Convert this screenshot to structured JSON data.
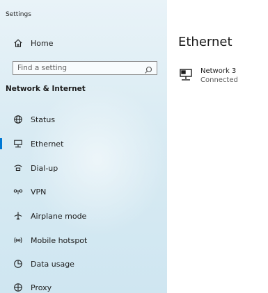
{
  "app": {
    "title": "Settings"
  },
  "sidebar": {
    "home_label": "Home",
    "search_placeholder": "Find a setting",
    "section_header": "Network & Internet",
    "items": [
      {
        "label": "Status",
        "icon": "globe-icon",
        "selected": false
      },
      {
        "label": "Ethernet",
        "icon": "ethernet-icon",
        "selected": true
      },
      {
        "label": "Dial-up",
        "icon": "dial-up-icon",
        "selected": false
      },
      {
        "label": "VPN",
        "icon": "vpn-icon",
        "selected": false
      },
      {
        "label": "Airplane mode",
        "icon": "airplane-icon",
        "selected": false
      },
      {
        "label": "Mobile hotspot",
        "icon": "hotspot-icon",
        "selected": false
      },
      {
        "label": "Data usage",
        "icon": "data-usage-icon",
        "selected": false
      },
      {
        "label": "Proxy",
        "icon": "proxy-globe-icon",
        "selected": false
      }
    ]
  },
  "main": {
    "title": "Ethernet",
    "network": {
      "name": "Network 3",
      "status": "Connected"
    }
  },
  "colors": {
    "accent": "#0078d4",
    "sidebar_bg": "#d9ebf3"
  }
}
